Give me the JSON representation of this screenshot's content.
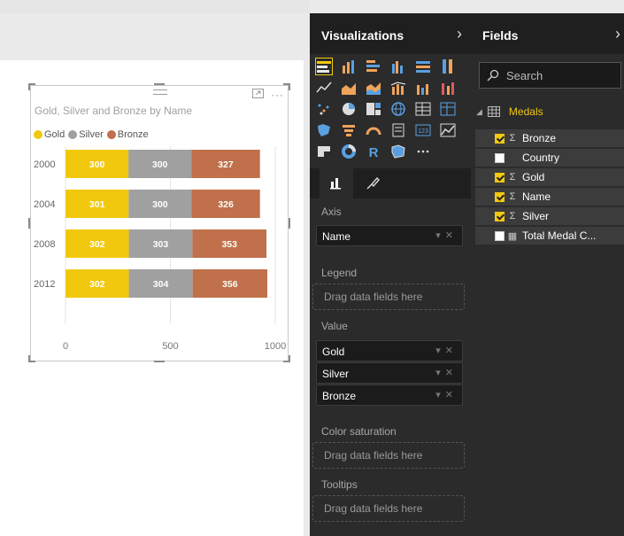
{
  "visual": {
    "title": "Gold, Silver and Bronze by Name",
    "legend": [
      {
        "label": "Gold",
        "color": "#f2c80f"
      },
      {
        "label": "Silver",
        "color": "#a0a0a0"
      },
      {
        "label": "Bronze",
        "color": "#c0704a"
      }
    ]
  },
  "chart_data": {
    "type": "bar",
    "orientation": "horizontal",
    "stacked": true,
    "title": "Gold, Silver and Bronze by Name",
    "categories": [
      "2000",
      "2004",
      "2008",
      "2012"
    ],
    "series": [
      {
        "name": "Gold",
        "values": [
          300,
          301,
          302,
          302
        ],
        "color": "#f2c80f"
      },
      {
        "name": "Silver",
        "values": [
          300,
          300,
          303,
          304
        ],
        "color": "#a0a0a0"
      },
      {
        "name": "Bronze",
        "values": [
          327,
          326,
          353,
          356
        ],
        "color": "#c0704a"
      }
    ],
    "xlim": [
      0,
      1000
    ],
    "xticks": [
      "0",
      "500",
      "1000"
    ],
    "grid": true,
    "legend_position": "top-left"
  },
  "viz_pane": {
    "title": "Visualizations",
    "sections": [
      {
        "label": "Axis",
        "fields": [
          "Name"
        ]
      },
      {
        "label": "Legend",
        "placeholder": "Drag data fields here"
      },
      {
        "label": "Value",
        "fields": [
          "Gold",
          "Silver",
          "Bronze"
        ]
      },
      {
        "label": "Color saturation",
        "placeholder": "Drag data fields here"
      },
      {
        "label": "Tooltips",
        "placeholder": "Drag data fields here"
      }
    ]
  },
  "fields_pane": {
    "title": "Fields",
    "search_placeholder": "Search",
    "table": "Medals",
    "fields": [
      {
        "label": "Bronze",
        "checked": true,
        "icon": "sigma"
      },
      {
        "label": "Country",
        "checked": false,
        "icon": ""
      },
      {
        "label": "Gold",
        "checked": true,
        "icon": "sigma"
      },
      {
        "label": "Name",
        "checked": true,
        "icon": "sigma"
      },
      {
        "label": "Silver",
        "checked": true,
        "icon": "sigma"
      },
      {
        "label": "Total Medal C...",
        "checked": false,
        "icon": "calculator"
      }
    ]
  }
}
